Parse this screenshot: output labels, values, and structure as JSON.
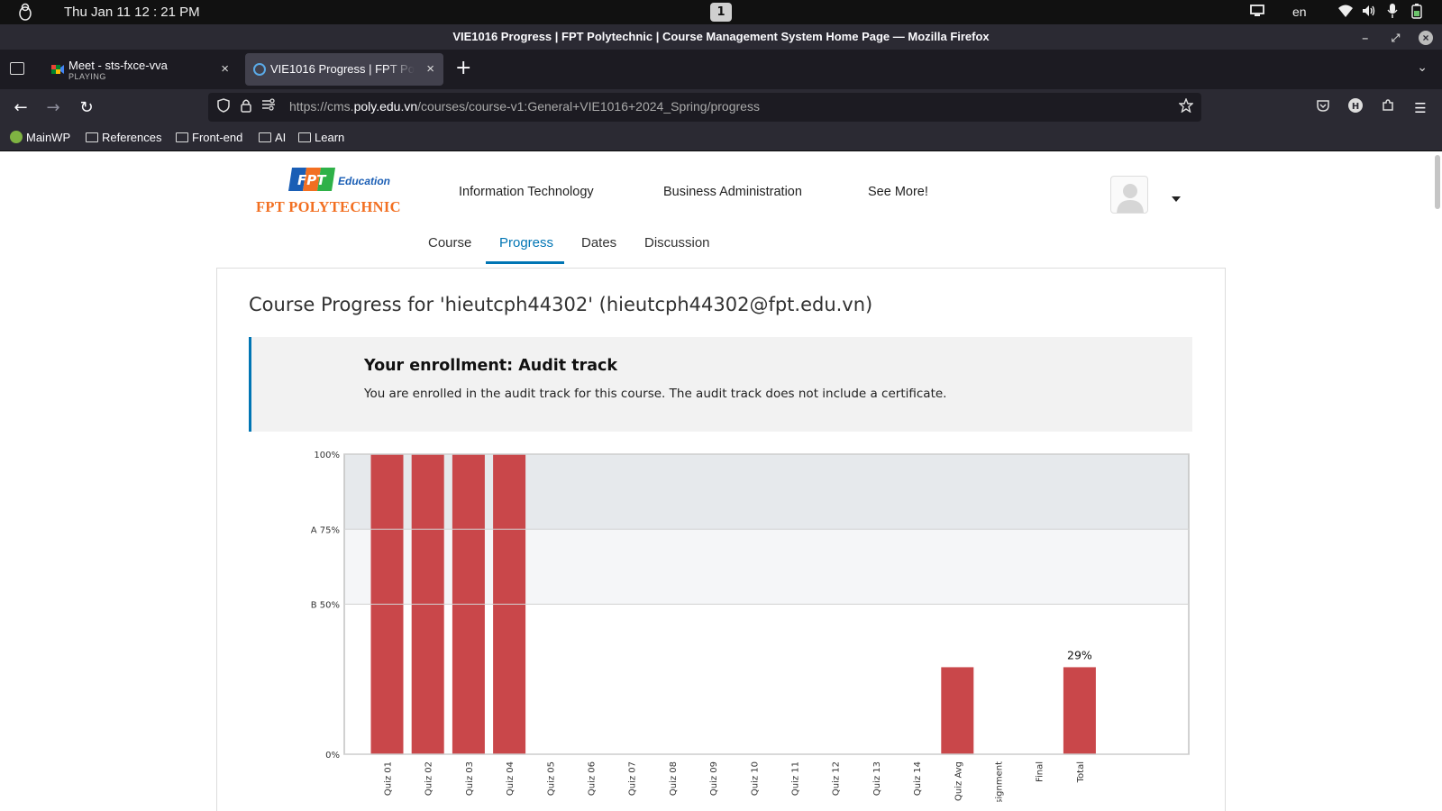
{
  "os": {
    "clock": "Thu Jan 11 12 : 21 PM",
    "workspace": "1",
    "language": "en"
  },
  "window": {
    "title": "VIE1016 Progress | FPT Polytechnic | Course Management System Home Page — Mozilla Firefox"
  },
  "tabs": [
    {
      "title": "Meet - sts-fxce-vva",
      "subtitle": "PLAYING"
    },
    {
      "title": "VIE1016 Progress | FPT Polytechnic"
    }
  ],
  "urlbar": {
    "prefix": "https://cms.",
    "domain": "poly.edu.vn",
    "path": "/courses/course-v1:General+VIE1016+2024_Spring/progress"
  },
  "bookmarks": [
    "MainWP",
    "References",
    "Front-end",
    "AI",
    "Learn"
  ],
  "site": {
    "logo_brand": "FPT",
    "logo_education": "Education",
    "logo_name": "FPT POLYTECHNIC",
    "top_nav": [
      "Information Technology",
      "Business Administration",
      "See More!"
    ],
    "course_nav": [
      "Course",
      "Progress",
      "Dates",
      "Discussion"
    ],
    "active_course_nav": "Progress"
  },
  "progress": {
    "heading": "Course Progress for 'hieutcph44302' (hieutcph44302@fpt.edu.vn)",
    "enrollment_title": "Your enrollment: Audit track",
    "enrollment_text": "You are enrolled in the audit track for this course. The audit track does not include a certificate."
  },
  "chart_data": {
    "type": "bar",
    "categories": [
      "Quiz 01",
      "Quiz 02",
      "Quiz 03",
      "Quiz 04",
      "Quiz 05",
      "Quiz 06",
      "Quiz 07",
      "Quiz 08",
      "Quiz 09",
      "Quiz 10",
      "Quiz 11",
      "Quiz 12",
      "Quiz 13",
      "Quiz 14",
      "Quiz Avg",
      "ssignment",
      "Final",
      "Total"
    ],
    "values": [
      100,
      100,
      100,
      100,
      0,
      0,
      0,
      0,
      0,
      0,
      0,
      0,
      0,
      0,
      29,
      0,
      0,
      29
    ],
    "ylim": [
      0,
      100
    ],
    "y_ticks": [
      {
        "value": 100,
        "label": "100%"
      },
      {
        "value": 75,
        "label": "A 75%"
      },
      {
        "value": 50,
        "label": "B 50%"
      },
      {
        "value": 0,
        "label": "0%"
      }
    ],
    "grade_bands": [
      {
        "from": 75,
        "to": 100,
        "color": "#e6e9ec"
      },
      {
        "from": 50,
        "to": 75,
        "color": "#f5f6f8"
      }
    ],
    "total_label": "29%",
    "bar_color": "#c9474a"
  }
}
